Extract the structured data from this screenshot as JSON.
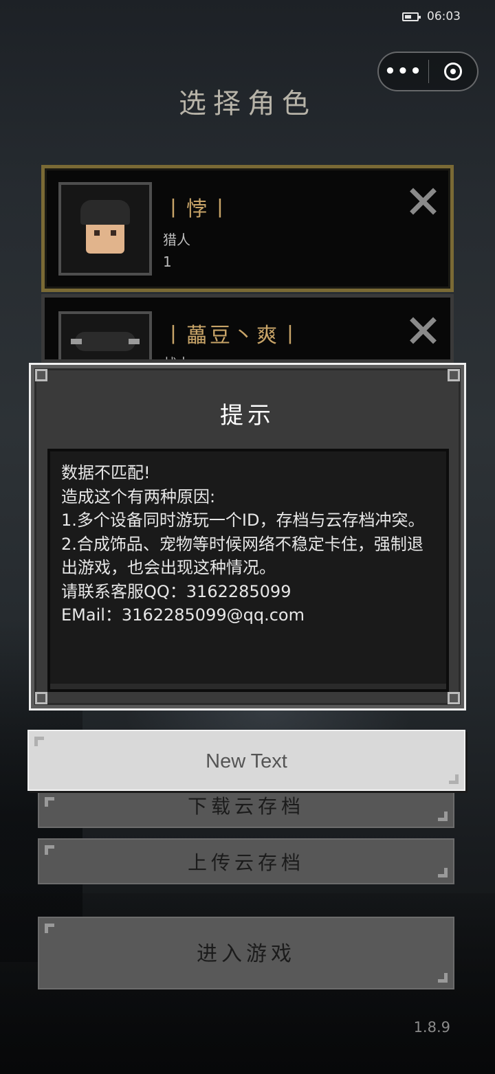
{
  "status_bar": {
    "time": "06:03",
    "battery_icon": "battery-icon"
  },
  "capsule": {
    "more_label": "•••",
    "more_icon": "more-dots-icon",
    "close_icon": "target-circle-icon"
  },
  "page": {
    "title": "选择角色"
  },
  "roles": [
    {
      "name": "丨悖丨",
      "class": "猎人",
      "level": "1"
    },
    {
      "name": "丨藟豆丶爽丨",
      "class": "战士",
      "level": ""
    }
  ],
  "dialog": {
    "title": "提示",
    "lines": [
      "数据不匹配!",
      "造成这个有两种原因:",
      "1.多个设备同时游玩一个ID，存档与云存档冲突。",
      "2.合成饰品、宠物等时候网络不稳定卡住，强制退出游戏，也会出现这种情况。",
      "请联系客服QQ：3162285099",
      "EMail：3162285099@qq.com"
    ]
  },
  "buttons": {
    "new_text": "New Text",
    "download": "下载云存档",
    "upload": "上传云存档",
    "enter": "进入游戏"
  },
  "version": "1.8.9"
}
